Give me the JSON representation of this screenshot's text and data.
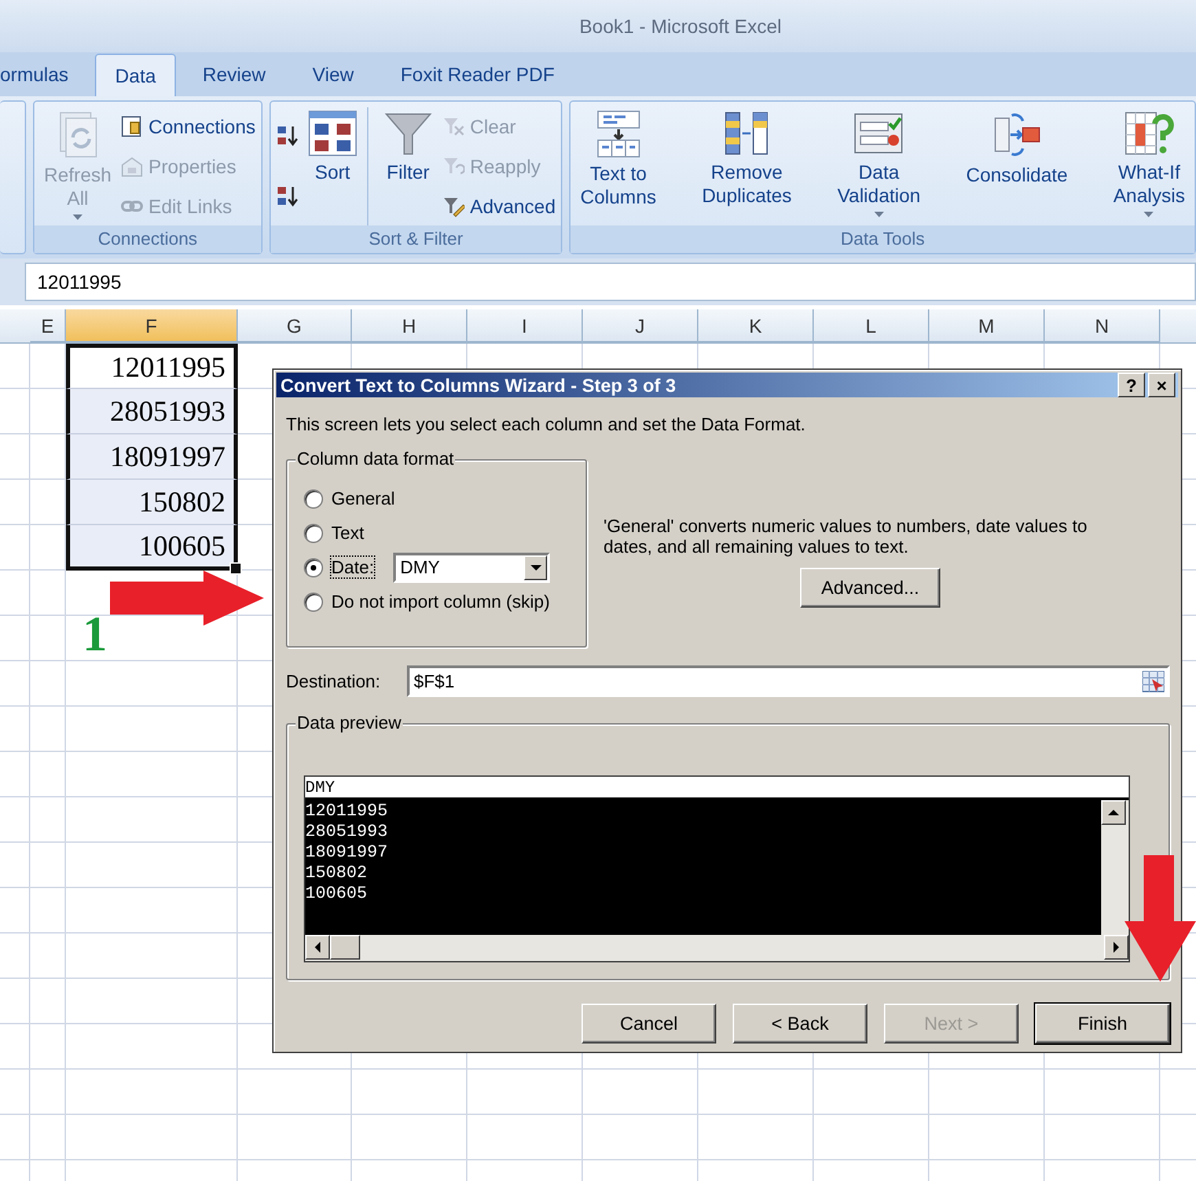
{
  "window": {
    "title": "Book1 - Microsoft Excel"
  },
  "tabs": [
    {
      "label": "ormulas",
      "selected": false
    },
    {
      "label": "Data",
      "selected": true
    },
    {
      "label": "Review",
      "selected": false
    },
    {
      "label": "View",
      "selected": false
    },
    {
      "label": "Foxit Reader PDF",
      "selected": false
    }
  ],
  "ribbon": {
    "groups": [
      {
        "label": "Connections",
        "columns": [
          [
            {
              "kind": "large",
              "label": "Refresh\nAll",
              "disabled": true,
              "has_menu": true
            }
          ],
          [
            {
              "kind": "small",
              "label": "Connections",
              "disabled": false
            },
            {
              "kind": "small",
              "label": "Properties",
              "disabled": true
            },
            {
              "kind": "small",
              "label": "Edit Links",
              "disabled": true
            }
          ]
        ]
      },
      {
        "label": "Sort & Filter",
        "columns": [
          [
            {
              "kind": "icon",
              "disabled": false
            },
            {
              "kind": "icon",
              "disabled": false
            }
          ],
          [
            {
              "kind": "large",
              "label": "Sort",
              "disabled": false
            }
          ],
          [
            {
              "kind": "large",
              "label": "Filter",
              "disabled": false
            }
          ],
          [
            {
              "kind": "small",
              "label": "Clear",
              "disabled": true
            },
            {
              "kind": "small",
              "label": "Reapply",
              "disabled": true
            },
            {
              "kind": "small",
              "label": "Advanced",
              "disabled": false
            }
          ]
        ]
      },
      {
        "label": "Data Tools",
        "columns": [
          [
            {
              "kind": "large",
              "label": "Text to\nColumns",
              "disabled": false
            }
          ],
          [
            {
              "kind": "large",
              "label": "Remove\nDuplicates",
              "disabled": false
            }
          ],
          [
            {
              "kind": "large",
              "label": "Data\nValidation",
              "disabled": false,
              "has_menu": true
            }
          ],
          [
            {
              "kind": "large",
              "label": "Consolidate",
              "disabled": false
            }
          ],
          [
            {
              "kind": "large",
              "label": "What-If\nAnalysis",
              "disabled": false,
              "has_menu": true
            }
          ]
        ]
      }
    ]
  },
  "formula_bar": {
    "value": "12011995"
  },
  "sheet": {
    "columns": [
      {
        "label": "E",
        "selected": false
      },
      {
        "label": "F",
        "selected": true
      },
      {
        "label": "G",
        "selected": false
      },
      {
        "label": "H",
        "selected": false
      },
      {
        "label": "I",
        "selected": false
      },
      {
        "label": "J",
        "selected": false
      },
      {
        "label": "K",
        "selected": false
      },
      {
        "label": "L",
        "selected": false
      },
      {
        "label": "M",
        "selected": false
      },
      {
        "label": "N",
        "selected": false
      }
    ],
    "cells": [
      {
        "value": "12011995",
        "active": true
      },
      {
        "value": "28051993",
        "active": false
      },
      {
        "value": "18091997",
        "active": false
      },
      {
        "value": "150802",
        "active": false
      },
      {
        "value": "100605",
        "active": false
      }
    ]
  },
  "annotations": {
    "step_number": "1"
  },
  "dialog": {
    "title": "Convert Text to Columns Wizard - Step 3 of 3",
    "help_button": "?",
    "close_button": "×",
    "intro": "This screen lets you select each column and set the Data Format.",
    "format_group": {
      "legend": "Column data format",
      "options": [
        {
          "label": "General",
          "selected": false
        },
        {
          "label": "Text",
          "selected": false
        },
        {
          "label": "Date:",
          "selected": true
        },
        {
          "label": "Do not import column (skip)",
          "selected": false
        }
      ],
      "date_format": "DMY"
    },
    "description": "'General' converts numeric values to numbers, date values to dates, and all remaining values to text.",
    "advanced_button": "Advanced...",
    "destination": {
      "label": "Destination:",
      "value": "$F$1"
    },
    "preview": {
      "legend": "Data preview",
      "header": "DMY",
      "rows": [
        "12011995",
        "28051993",
        "18091997",
        "150802",
        "100605"
      ]
    },
    "buttons": [
      {
        "label": "Cancel",
        "disabled": false,
        "default": false
      },
      {
        "label": "< Back",
        "disabled": false,
        "default": false
      },
      {
        "label": "Next >",
        "disabled": true,
        "default": false
      },
      {
        "label": "Finish",
        "disabled": false,
        "default": true
      }
    ]
  }
}
